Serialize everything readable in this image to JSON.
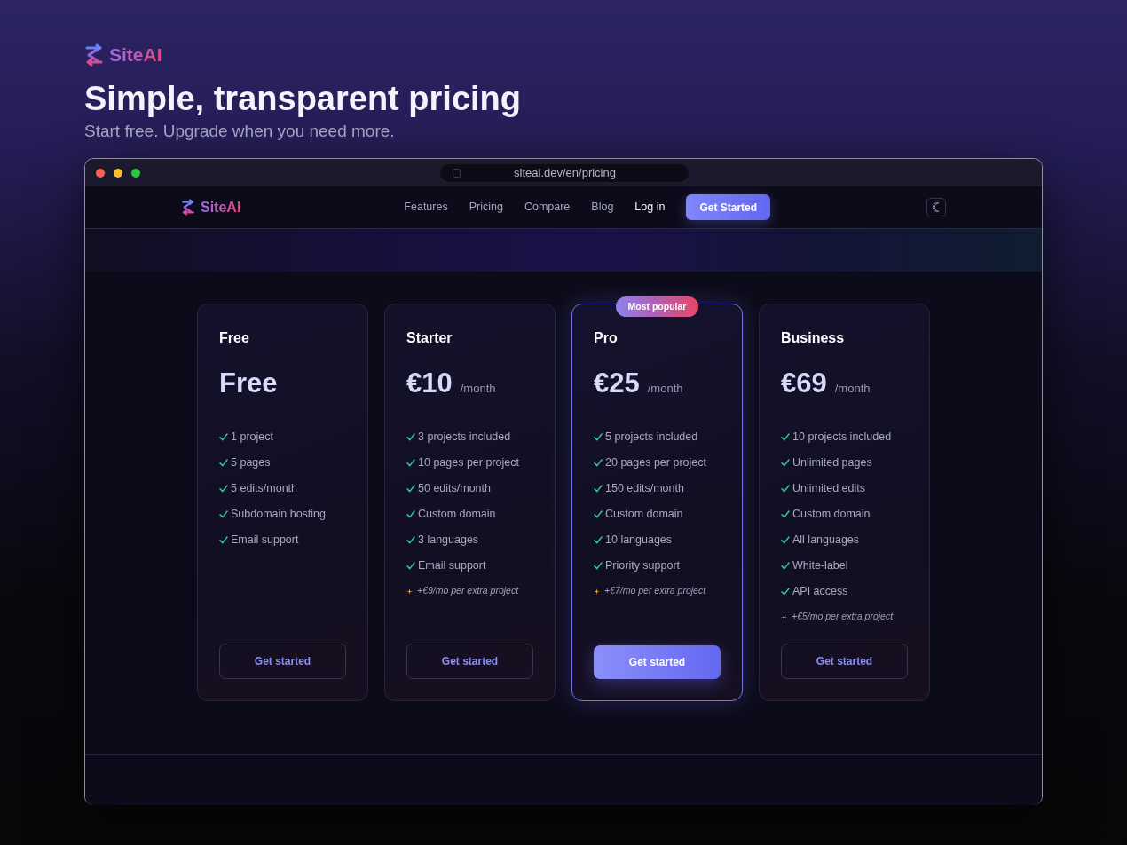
{
  "brand": {
    "name": "SiteAI"
  },
  "heading": {
    "title": "Simple, transparent pricing",
    "subtitle": "Start free. Upgrade when you need more."
  },
  "browser_window": {
    "url": "siteai.dev/en/pricing"
  },
  "navbar": {
    "brand": "SiteAI",
    "links": [
      {
        "label": "Features",
        "kind": "link"
      },
      {
        "label": "Pricing",
        "kind": "link"
      },
      {
        "label": "Compare",
        "kind": "link"
      },
      {
        "label": "Blog",
        "kind": "link"
      },
      {
        "label": "Log in",
        "kind": "login"
      }
    ],
    "cta": "Get Started"
  },
  "plans": [
    {
      "name": "Free",
      "price": "Free",
      "highlighted": false,
      "features": [
        {
          "kind": "check",
          "text": "1 project"
        },
        {
          "kind": "check",
          "text": "5 pages"
        },
        {
          "kind": "check",
          "text": "5 edits/month"
        },
        {
          "kind": "check",
          "text": "Subdomain hosting"
        },
        {
          "kind": "check",
          "text": "Email support"
        }
      ],
      "button": "Get started"
    },
    {
      "name": "Starter",
      "price": "€10",
      "period": "/month",
      "highlighted": false,
      "features": [
        {
          "kind": "check",
          "text": "3 projects included"
        },
        {
          "kind": "check",
          "text": "10 pages per project"
        },
        {
          "kind": "check",
          "text": "50 edits/month"
        },
        {
          "kind": "check",
          "text": "Custom domain"
        },
        {
          "kind": "check",
          "text": "3 languages"
        },
        {
          "kind": "check",
          "text": "Email support"
        },
        {
          "kind": "extra",
          "text": "+€9/mo per extra project"
        }
      ],
      "button": "Get started"
    },
    {
      "name": "Pro",
      "price": "€25",
      "period": "/month",
      "highlighted": true,
      "badge": "Most popular",
      "features": [
        {
          "kind": "check",
          "text": "5 projects included"
        },
        {
          "kind": "check",
          "text": "20 pages per project"
        },
        {
          "kind": "check",
          "text": "150 edits/month"
        },
        {
          "kind": "check",
          "text": "Custom domain"
        },
        {
          "kind": "check",
          "text": "10 languages"
        },
        {
          "kind": "check",
          "text": "Priority support"
        },
        {
          "kind": "extra",
          "text": "+€7/mo per extra project"
        }
      ],
      "button": "Get started"
    },
    {
      "name": "Business",
      "price": "€69",
      "period": "/month",
      "highlighted": false,
      "features": [
        {
          "kind": "check",
          "text": "10 projects included"
        },
        {
          "kind": "check",
          "text": "Unlimited pages"
        },
        {
          "kind": "check",
          "text": "Unlimited edits"
        },
        {
          "kind": "check",
          "text": "Custom domain"
        },
        {
          "kind": "check",
          "text": "All languages"
        },
        {
          "kind": "check",
          "text": "White-label"
        },
        {
          "kind": "check",
          "text": "API access"
        },
        {
          "kind": "extra",
          "text": "+€5/mo per extra project"
        }
      ],
      "button": "Get started"
    }
  ]
}
